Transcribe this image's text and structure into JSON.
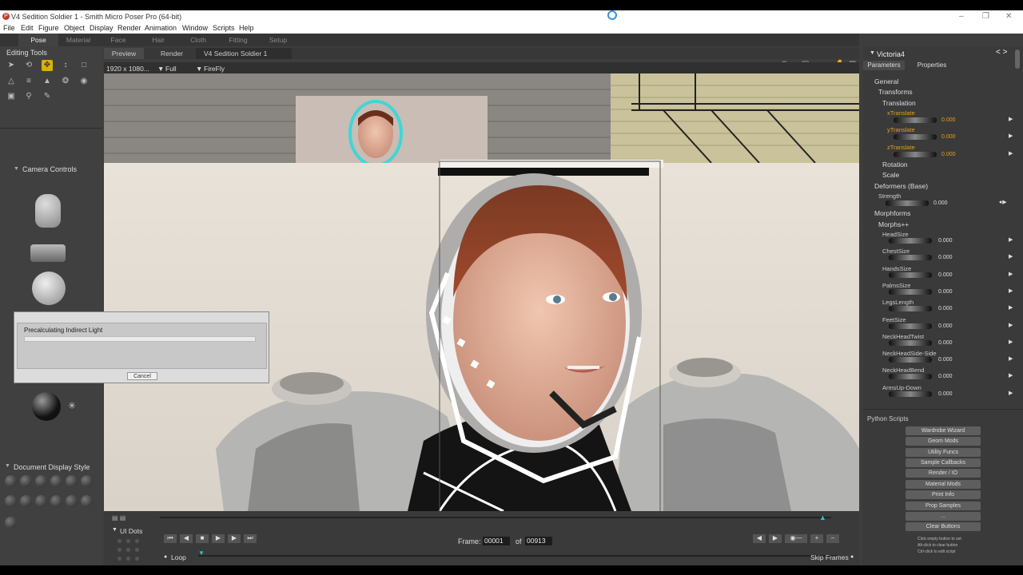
{
  "window": {
    "title": "V4 Sedition Soldier 1 - Smith Micro Poser Pro  (64-bit)",
    "app_icon": "poser-icon"
  },
  "menu": [
    "File",
    "Edit",
    "Figure",
    "Object",
    "Display",
    "Render",
    "Animation",
    "Window",
    "Scripts",
    "Help"
  ],
  "rooms": [
    "Pose",
    "Material",
    "Face",
    "Hair",
    "Cloth",
    "Fitting",
    "Setup"
  ],
  "active_room": "Pose",
  "editing_tools": {
    "title": "Editing Tools"
  },
  "camera_controls": {
    "title": "Camera Controls"
  },
  "document_display": {
    "title": "Document Display Style"
  },
  "viewport": {
    "tabs": [
      "Preview",
      "Render"
    ],
    "doc_title": "V4 Sedition Soldier 1",
    "resolution": "1920 x 1080...",
    "size_option": "Full",
    "renderer": "FireFly"
  },
  "dialog": {
    "message": "Precalculating Indirect Light",
    "cancel": "Cancel",
    "progress": 0.0
  },
  "right_panel": {
    "figure": "Victoria4",
    "tabs": [
      "Parameters",
      "Properties"
    ],
    "groups": {
      "general": "General",
      "transforms": "Transforms",
      "translation": "Translation",
      "rotation": "Rotation",
      "scale": "Scale",
      "deformers": "Deformers (Base)",
      "morphforms": "Morphforms",
      "morphs": "Morphs++"
    },
    "translation": [
      {
        "name": "xTranslate",
        "value": "0.000"
      },
      {
        "name": "yTranslate",
        "value": "0.000"
      },
      {
        "name": "zTranslate",
        "value": "0.000"
      }
    ],
    "strength": {
      "name": "Strength",
      "value": "0.000"
    },
    "morphs": [
      {
        "name": "HeadSize",
        "value": "0.000"
      },
      {
        "name": "ChestSize",
        "value": "0.000"
      },
      {
        "name": "HandsSize",
        "value": "0.000"
      },
      {
        "name": "PalmsSize",
        "value": "0.000"
      },
      {
        "name": "LegsLength",
        "value": "0.000"
      },
      {
        "name": "FeetSize",
        "value": "0.000"
      },
      {
        "name": "NeckHeadTwist",
        "value": "0.000"
      },
      {
        "name": "NeckHeadSide-Side",
        "value": "0.000"
      },
      {
        "name": "NeckHeadBend",
        "value": "0.000"
      },
      {
        "name": "ArmsUp-Down",
        "value": "0.000"
      }
    ]
  },
  "python": {
    "title": "Python Scripts",
    "buttons": [
      "Wardrobe Wizard",
      "Geom Mods",
      "Utility Funcs",
      "Sample Callbacks",
      "Render / IO",
      "Material Mods",
      "Print Info",
      "Prop Samples",
      "...",
      "Clear Buttons"
    ],
    "hint": [
      "Click empty button to set",
      "Alt-click to clear button",
      "Ctrl-click to edit script"
    ]
  },
  "timeline": {
    "ui_dots": "UI Dots",
    "frame_label": "Frame:",
    "frame": "00001",
    "of": "of",
    "total": "00913",
    "loop": "Loop",
    "skip": "Skip Frames"
  },
  "colors": {
    "accent": "#d8b300",
    "highlight": "#e0a020",
    "panel": "#3d3d3d"
  }
}
